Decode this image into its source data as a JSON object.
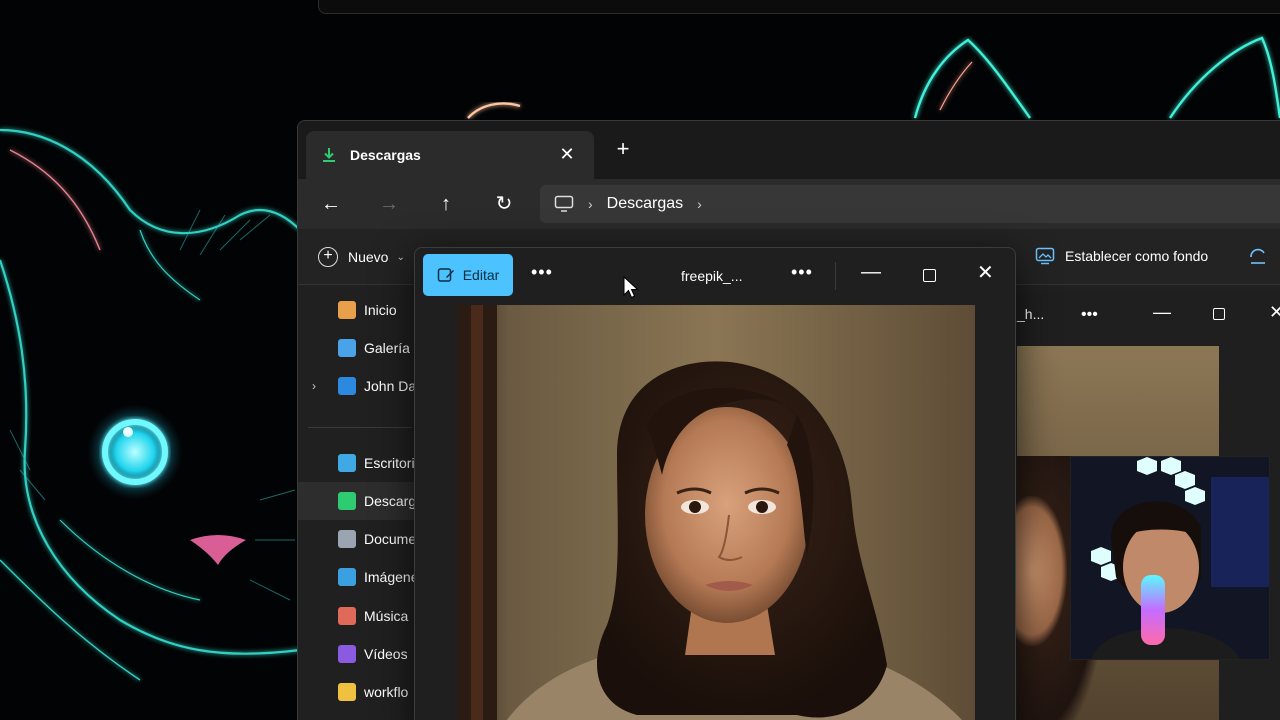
{
  "explorer": {
    "tab_label": "Descargas",
    "tab_close": "✕",
    "new_tab": "+",
    "nav": {
      "back": "←",
      "forward": "→",
      "up": "↑",
      "refresh": "↻"
    },
    "address": {
      "sep1": "›",
      "folder": "Descargas",
      "sep2": "›"
    },
    "command_bar": {
      "new_label": "Nuevo",
      "new_chevron": "⌄",
      "set_wallpaper_label": "Establecer como fondo"
    },
    "sidebar": [
      {
        "label": "Inicio",
        "icon": "home-icon",
        "color": "#e8a04a"
      },
      {
        "label": "Galería",
        "icon": "gallery-icon",
        "color": "#4aa3e8"
      },
      {
        "label": "John Da",
        "icon": "onedrive-cloud-icon",
        "color": "#2b8ae0",
        "expand": "›"
      },
      {
        "label": "Escritori",
        "icon": "desktop-icon",
        "color": "#3fa9e6"
      },
      {
        "label": "Descarg",
        "icon": "download-icon",
        "color": "#2ecc71",
        "selected": true
      },
      {
        "label": "Docume",
        "icon": "document-icon",
        "color": "#9aa5b1"
      },
      {
        "label": "Imágene",
        "icon": "pictures-icon",
        "color": "#3aa0e0"
      },
      {
        "label": "Música",
        "icon": "music-icon",
        "color": "#e06a5a"
      },
      {
        "label": "Vídeos",
        "icon": "videos-icon",
        "color": "#8a5ae0"
      },
      {
        "label": "workflo",
        "icon": "folder-icon",
        "color": "#f0c040"
      }
    ]
  },
  "viewer": {
    "edit_label": "Editar",
    "more1": "•••",
    "title": "freepik_...",
    "more2": "•••",
    "minimize": "—",
    "close": "✕"
  },
  "back_viewer": {
    "title": "_h...",
    "more": "•••",
    "minimize": "—",
    "close": "✕"
  },
  "colors": {
    "accent": "#4cc2ff",
    "neon_cyan": "#3ff0e0",
    "window_bg": "#202020"
  }
}
